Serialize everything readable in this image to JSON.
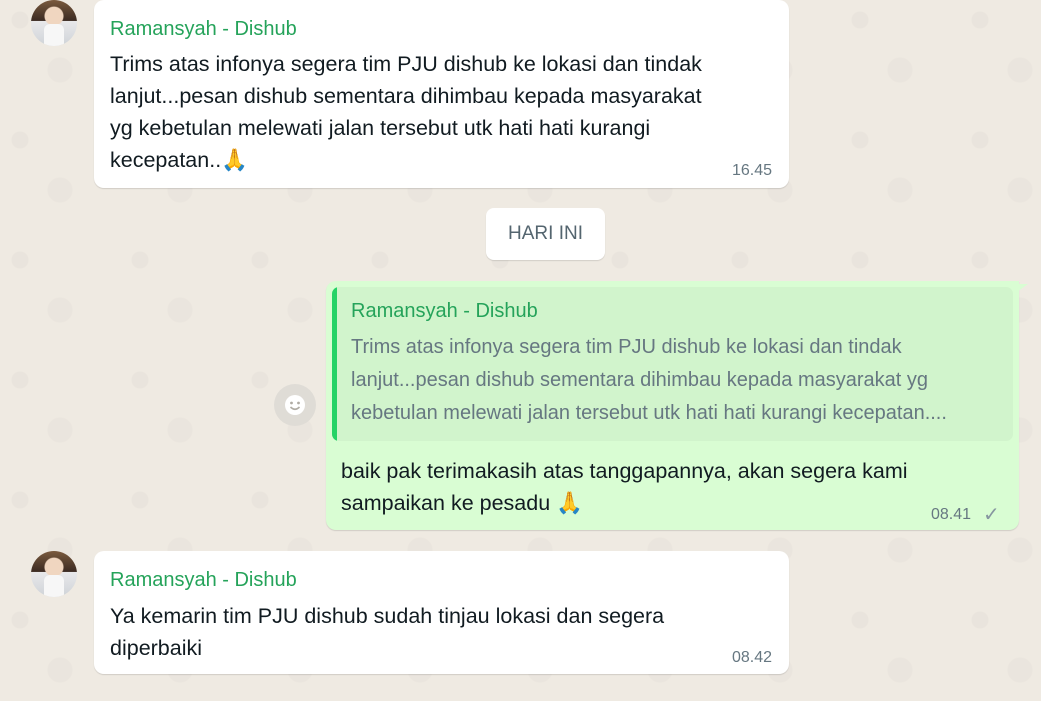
{
  "messages": [
    {
      "sender": "Ramansyah - Dishub",
      "text": "Trims atas infonya segera tim PJU dishub ke lokasi dan tindak\nlanjut...pesan dishub sementara dihimbau kepada masyarakat\nyg kebetulan melewati jalan tersebut utk hati hati kurangi\nkecepatan..",
      "emoji": "🙏",
      "time": "16.45"
    },
    {
      "sender": "Ramansyah - Dishub",
      "text": "Ya kemarin tim PJU dishub sudah tinjau lokasi dan segera\ndiperbaiki",
      "time": "08.42"
    }
  ],
  "date_divider": "HARI INI",
  "reply": {
    "quote_sender": "Ramansyah - Dishub",
    "quote_text": "Trims atas infonya segera tim PJU dishub ke lokasi dan tindak\nlanjut...pesan dishub sementara dihimbau kepada masyarakat yg\nkebetulan melewati jalan tersebut utk hati hati kurangi kecepatan....",
    "text": "baik pak terimakasih atas tanggapannya, akan segera kami\nsampaikan ke pesadu",
    "emoji": "🙏",
    "time": "08.41",
    "status_icon": "single-check-icon"
  },
  "colors": {
    "background": "#efeae2",
    "incoming": "#ffffff",
    "outgoing": "#d9fdd3",
    "sender": "#25a35a"
  }
}
